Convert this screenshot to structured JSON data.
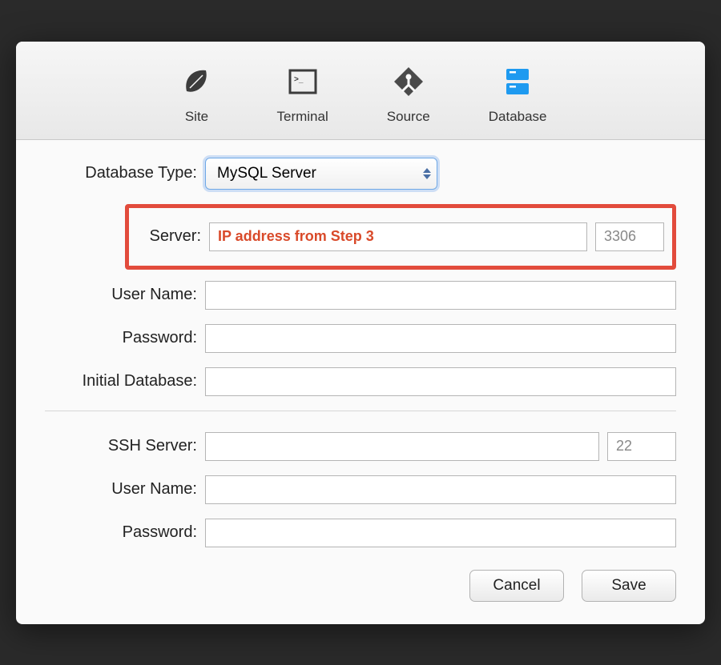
{
  "toolbar": {
    "tabs": [
      {
        "id": "site",
        "label": "Site",
        "selected": false
      },
      {
        "id": "terminal",
        "label": "Terminal",
        "selected": false
      },
      {
        "id": "source",
        "label": "Source",
        "selected": false
      },
      {
        "id": "database",
        "label": "Database",
        "selected": true
      }
    ]
  },
  "form": {
    "database_type": {
      "label": "Database Type:",
      "value": "MySQL Server"
    },
    "server": {
      "label": "Server:",
      "host_placeholder": "IP address from Step 3",
      "host_value": "",
      "port_value": "3306"
    },
    "username": {
      "label": "User Name:",
      "value": ""
    },
    "password": {
      "label": "Password:",
      "value": ""
    },
    "initial_db": {
      "label": "Initial Database:",
      "value": ""
    },
    "ssh_server": {
      "label": "SSH Server:",
      "host_value": "",
      "port_value": "22"
    },
    "ssh_username": {
      "label": "User Name:",
      "value": ""
    },
    "ssh_password": {
      "label": "Password:",
      "value": ""
    }
  },
  "buttons": {
    "cancel": "Cancel",
    "save": "Save"
  },
  "colors": {
    "highlight": "#e24b3c",
    "selected_icon": "#1e9af0"
  }
}
